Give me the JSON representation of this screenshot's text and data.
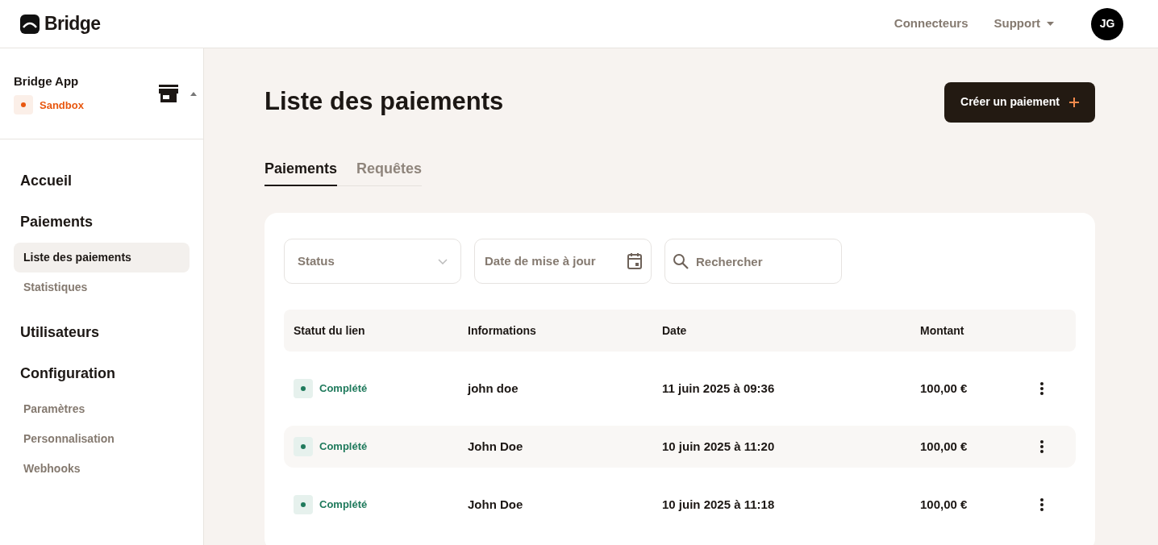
{
  "header": {
    "logo": "Bridge",
    "links": [
      {
        "label": "Connecteurs",
        "dropdown": false
      },
      {
        "label": "Support",
        "dropdown": true
      }
    ],
    "avatar": "JG"
  },
  "workspace": {
    "name": "Bridge App",
    "environment": "Sandbox",
    "expanded": true
  },
  "sidebar": {
    "sections": [
      {
        "label": "Accueil"
      },
      {
        "label": "Paiements",
        "items": [
          {
            "label": "Liste des paiements",
            "selected": true
          },
          {
            "label": "Statistiques",
            "selected": false
          }
        ]
      },
      {
        "label": "Utilisateurs"
      },
      {
        "label": "Configuration",
        "items": [
          {
            "label": "Paramètres",
            "selected": false
          },
          {
            "label": "Personnalisation",
            "selected": false
          },
          {
            "label": "Webhooks",
            "selected": false
          }
        ]
      }
    ]
  },
  "page": {
    "title": "Liste des paiements",
    "create_button": "Créer un paiement"
  },
  "tabs": [
    {
      "label": "Paiements",
      "selected": true
    },
    {
      "label": "Requêtes",
      "selected": false
    }
  ],
  "filters": {
    "status": {
      "placeholder": "Status"
    },
    "date": {
      "placeholder": "Date de mise à jour"
    },
    "search": {
      "placeholder": "Rechercher"
    }
  },
  "table": {
    "columns": [
      "Statut du lien",
      "Informations",
      "Date",
      "Montant"
    ],
    "rows": [
      {
        "status": "Complété",
        "color": "#1f7a5c",
        "info": "john doe",
        "date": "11 juin 2025 à 09:36",
        "amount": "100,00 €"
      },
      {
        "status": "Complété",
        "color": "#1f7a5c",
        "info": "John Doe",
        "date": "10 juin 2025 à 11:20",
        "amount": "100,00 €"
      },
      {
        "status": "Complété",
        "color": "#1f7a5c",
        "info": "John Doe",
        "date": "10 juin 2025 à 11:18",
        "amount": "100,00 €"
      }
    ]
  }
}
